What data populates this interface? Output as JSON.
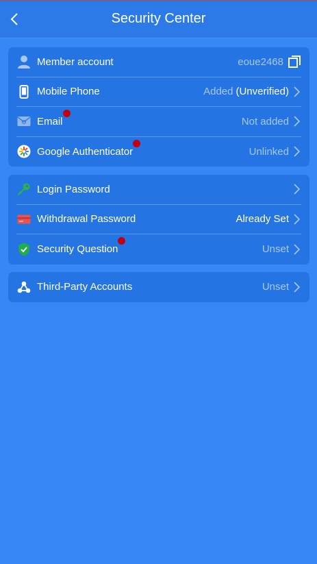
{
  "header": {
    "title": "Security Center",
    "back_icon": "chevron-left-icon"
  },
  "colors": {
    "background": "#3688f6",
    "card": "#2574e4",
    "muted_text": "#a9c8f3",
    "alert_dot": "#c30010"
  },
  "account_card": {
    "rows": [
      {
        "label": "Member account",
        "value": "eoue2468",
        "icon": "user-icon"
      },
      {
        "label": "Mobile Phone",
        "value": "Added",
        "value_strong": "(Unverified)",
        "icon": "phone-icon"
      },
      {
        "label": "Email",
        "value": "Not added",
        "icon": "email-icon",
        "alert": true
      },
      {
        "label": "Google Authenticator",
        "value": "Unlinked",
        "icon": "google-authenticator-icon",
        "alert": true
      }
    ]
  },
  "password_card": {
    "rows": [
      {
        "label": "Login Password",
        "value": "",
        "icon": "key-icon"
      },
      {
        "label": "Withdrawal Password",
        "value": "Already Set",
        "icon": "card-icon"
      },
      {
        "label": "Security Question",
        "value": "Unset",
        "icon": "shield-check-icon",
        "alert": true
      }
    ]
  },
  "third_party_card": {
    "rows": [
      {
        "label": "Third-Party Accounts",
        "value": "Unset",
        "icon": "share-network-icon"
      }
    ]
  }
}
